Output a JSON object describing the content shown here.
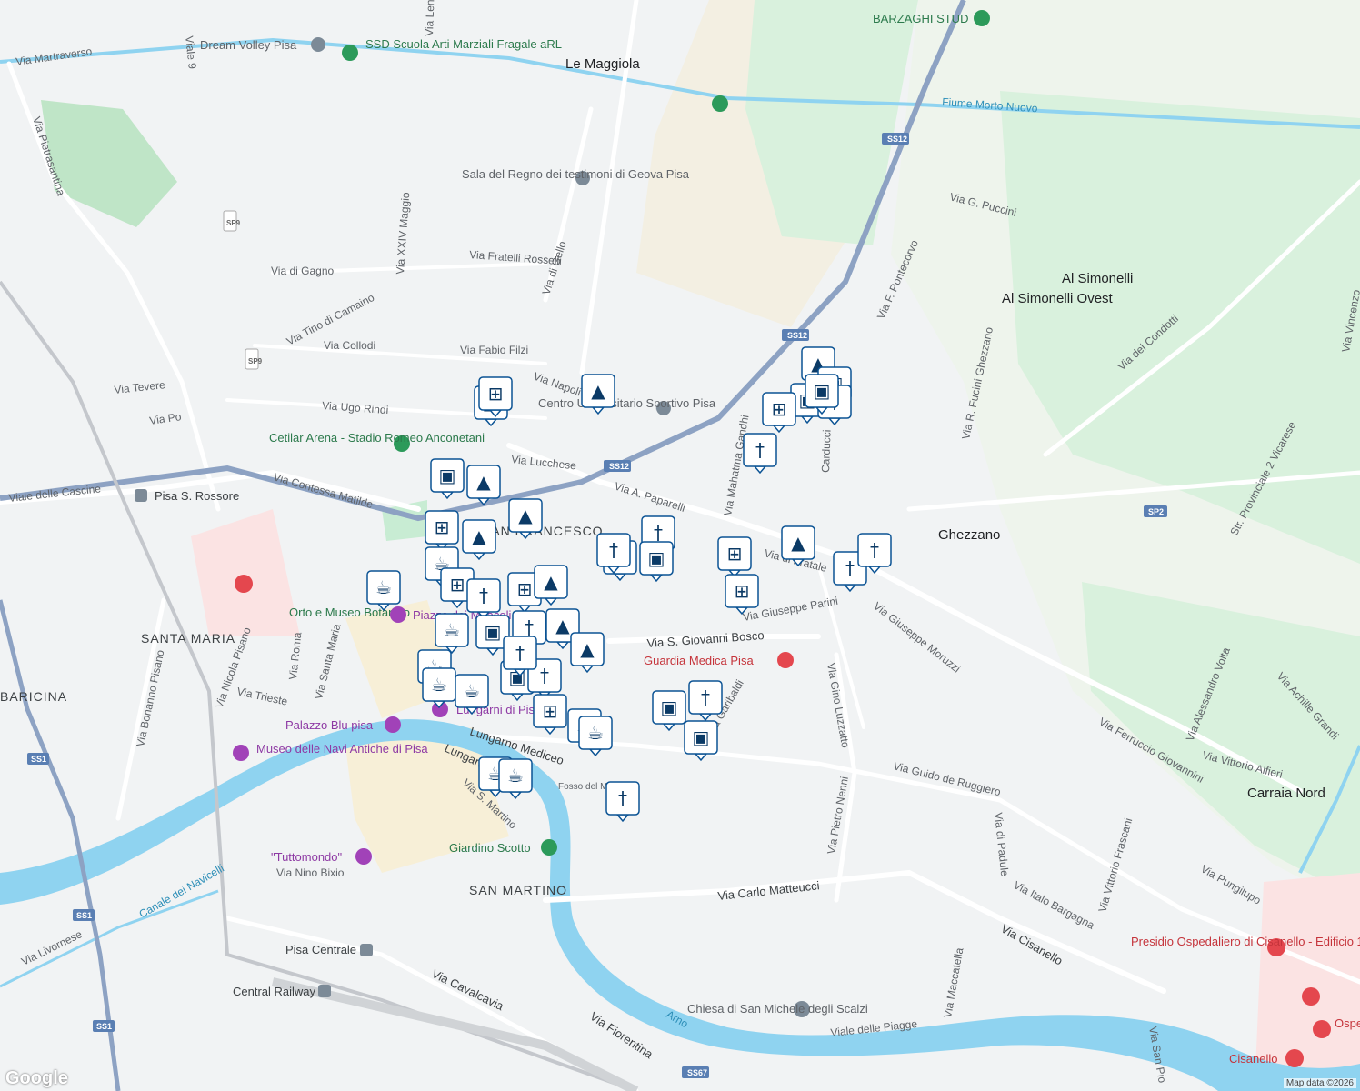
{
  "map": {
    "attribution": "Map data ©2026",
    "logo": "Google",
    "colors": {
      "water": "#8fd3f0",
      "park": "#c8ecd3",
      "road": "#ffffff",
      "highway": "#8da2c3",
      "background": "#f1f3f4",
      "pin": "#0b5394"
    },
    "place_labels": [
      {
        "text": "Le Maggiola"
      },
      {
        "text": "Al Simonelli"
      },
      {
        "text": "Al Simonelli Ovest"
      },
      {
        "text": "Ghezzano"
      },
      {
        "text": "Carraia Nord"
      }
    ],
    "district_labels": [
      {
        "text": "SANTA MARIA"
      },
      {
        "text": "BARICINA"
      },
      {
        "text": "SAN MARTINO"
      },
      {
        "text": "SAN FRANCESCO"
      }
    ],
    "street_labels": [
      {
        "text": "Via Martraverso"
      },
      {
        "text": "Via Pietrasantina"
      },
      {
        "text": "Via di Gello"
      },
      {
        "text": "Via Fratelli Rosselli"
      },
      {
        "text": "Via di Gagno"
      },
      {
        "text": "Via XXIV Maggio"
      },
      {
        "text": "Via Tino di Camaino"
      },
      {
        "text": "Via Collodi"
      },
      {
        "text": "Via Fabio Filzi"
      },
      {
        "text": "Via Tevere"
      },
      {
        "text": "Via Po"
      },
      {
        "text": "Via Ugo Rindi"
      },
      {
        "text": "Via Napoli"
      },
      {
        "text": "Via Lucchese"
      },
      {
        "text": "Via A. Paparelli"
      },
      {
        "text": "Via Contessa Matilde"
      },
      {
        "text": "Viale delle Cascine"
      },
      {
        "text": "Via G. Puccini"
      },
      {
        "text": "Via F. Pontecorvo"
      },
      {
        "text": "Via dei Condotti"
      },
      {
        "text": "Via di Fratale"
      },
      {
        "text": "Via Giuseppe Parini"
      },
      {
        "text": "Via S. Giovanni Bosco"
      },
      {
        "text": "Via Giuseppe Moruzzi"
      },
      {
        "text": "Via Gino Luzzatto"
      },
      {
        "text": "Via Ferruccio Giovannini"
      },
      {
        "text": "Via Alessandro Volta"
      },
      {
        "text": "Via Achille Grandi"
      },
      {
        "text": "Via Vittorio Alfieri"
      },
      {
        "text": "Via Guido de Ruggiero"
      },
      {
        "text": "Via di Padule"
      },
      {
        "text": "Via Pietro Nenni"
      },
      {
        "text": "Via Carlo Matteucci"
      },
      {
        "text": "Via Italo Bargagna"
      },
      {
        "text": "Via Vittorio Frascani"
      },
      {
        "text": "Via Pungilupo"
      },
      {
        "text": "Via Cisanello"
      },
      {
        "text": "Via Maccatella"
      },
      {
        "text": "Viale delle Piagge"
      },
      {
        "text": "Via San Pio"
      },
      {
        "text": "Via Fiorentina"
      },
      {
        "text": "Via Cavalcavia"
      },
      {
        "text": "Via Livornese"
      },
      {
        "text": "Canale dei Navicelli"
      },
      {
        "text": "Via Nino Bixio"
      },
      {
        "text": "Lungarno Mediceo"
      },
      {
        "text": "Lungarno Galilei"
      },
      {
        "text": "Via S. Martino"
      },
      {
        "text": "Via Bonanno Pisano"
      },
      {
        "text": "Via Nicola Pisano"
      },
      {
        "text": "Via Trieste"
      },
      {
        "text": "Via Roma"
      },
      {
        "text": "Via Santa Maria"
      },
      {
        "text": "Fiume Morto Nuovo"
      },
      {
        "text": "Via Mahatma Gandhi"
      },
      {
        "text": "Via R. Fucini Ghezzano"
      },
      {
        "text": "Str. Provinciale 2 Vicarese"
      },
      {
        "text": "Arno"
      },
      {
        "text": "Fosso del Mulino"
      },
      {
        "text": "Via Garibaldi"
      },
      {
        "text": "Carducci"
      },
      {
        "text": "Via Vincenzo"
      },
      {
        "text": "Via Lenin"
      },
      {
        "text": "Viale 9"
      }
    ],
    "road_shields": [
      {
        "text": "SS12"
      },
      {
        "text": "SS12"
      },
      {
        "text": "SS12"
      },
      {
        "text": "SS1"
      },
      {
        "text": "SS1"
      },
      {
        "text": "SS1"
      },
      {
        "text": "SS67"
      },
      {
        "text": "SP2"
      },
      {
        "text": "SP9"
      },
      {
        "text": "SP9"
      }
    ],
    "pois": [
      {
        "text": "Dream Volley Pisa",
        "kind": "green"
      },
      {
        "text": "SSD Scuola Arti Marziali Fragale aRL",
        "kind": "green"
      },
      {
        "text": "BARZAGHI STUD",
        "kind": "green"
      },
      {
        "text": "Sala del Regno dei testimoni di Geova Pisa",
        "kind": "gray"
      },
      {
        "text": "Centro Universitario Sportivo Pisa",
        "kind": "gray"
      },
      {
        "text": "Cetilar Arena - Stadio Romeo Anconetani",
        "kind": "green"
      },
      {
        "text": "Pisa S. Rossore",
        "kind": "gray"
      },
      {
        "text": "Orto e Museo Botanico",
        "kind": "green"
      },
      {
        "text": "Piazza dei Miracoli",
        "kind": "purple"
      },
      {
        "text": "Guardia Medica Pisa",
        "kind": "red"
      },
      {
        "text": "Lungarni di Pisa",
        "kind": "purple"
      },
      {
        "text": "Palazzo Blu pisa",
        "kind": "purple"
      },
      {
        "text": "Museo delle Navi Antiche di Pisa",
        "kind": "purple"
      },
      {
        "text": "Giardino Scotto",
        "kind": "green"
      },
      {
        "text": "\"Tuttomondo\"",
        "kind": "purple"
      },
      {
        "text": "Pisa Centrale",
        "kind": "gray"
      },
      {
        "text": "Central Railway",
        "kind": "gray"
      },
      {
        "text": "Chiesa di San Michele degli Scalzi",
        "kind": "gray"
      },
      {
        "text": "Presidio Ospedaliero di Cisanello - Edificio 1",
        "kind": "red"
      },
      {
        "text": "Cisanello",
        "kind": "red"
      },
      {
        "text": "Ospedale UO U",
        "kind": "red"
      }
    ],
    "markers": [
      {
        "icon": "shopping-bag-icon"
      },
      {
        "icon": "shopping-cart-icon"
      },
      {
        "icon": "school-icon"
      },
      {
        "icon": "shopping-bag-icon"
      },
      {
        "icon": "school-icon"
      },
      {
        "icon": "shopping-cart-icon"
      },
      {
        "icon": "school-icon"
      },
      {
        "icon": "school-icon"
      },
      {
        "icon": "coffee-icon"
      },
      {
        "icon": "shopping-cart-icon"
      },
      {
        "icon": "restaurant-icon"
      },
      {
        "icon": "shopping-cart-icon"
      },
      {
        "icon": "school-icon"
      },
      {
        "icon": "coffee-icon"
      },
      {
        "icon": "coffee-icon"
      },
      {
        "icon": "shopping-bag-icon"
      },
      {
        "icon": "restaurant-icon"
      },
      {
        "icon": "school-icon"
      },
      {
        "icon": "school-icon"
      },
      {
        "icon": "coffee-icon"
      },
      {
        "icon": "coffee-icon"
      },
      {
        "icon": "coffee-icon"
      },
      {
        "icon": "shopping-bag-icon"
      },
      {
        "icon": "restaurant-icon"
      },
      {
        "icon": "restaurant-icon"
      },
      {
        "icon": "shopping-cart-icon"
      },
      {
        "icon": "coffee-icon"
      },
      {
        "icon": "coffee-icon"
      },
      {
        "icon": "coffee-icon"
      },
      {
        "icon": "coffee-icon"
      },
      {
        "icon": "restaurant-icon"
      },
      {
        "icon": "restaurant-icon"
      },
      {
        "icon": "shopping-bag-icon"
      },
      {
        "icon": "restaurant-icon"
      },
      {
        "icon": "shopping-cart-icon"
      },
      {
        "icon": "shopping-cart-icon"
      },
      {
        "icon": "school-icon"
      },
      {
        "icon": "restaurant-icon"
      },
      {
        "icon": "restaurant-icon"
      },
      {
        "icon": "shopping-bag-icon"
      },
      {
        "icon": "restaurant-icon"
      },
      {
        "icon": "shopping-bag-icon"
      },
      {
        "icon": "restaurant-icon"
      },
      {
        "icon": "school-icon"
      },
      {
        "icon": "shopping-bag-icon"
      },
      {
        "icon": "shopping-cart-icon"
      },
      {
        "icon": "shopping-bag-icon"
      },
      {
        "icon": "restaurant-icon"
      },
      {
        "icon": "restaurant-icon"
      },
      {
        "icon": "shopping-bag-icon"
      }
    ]
  }
}
